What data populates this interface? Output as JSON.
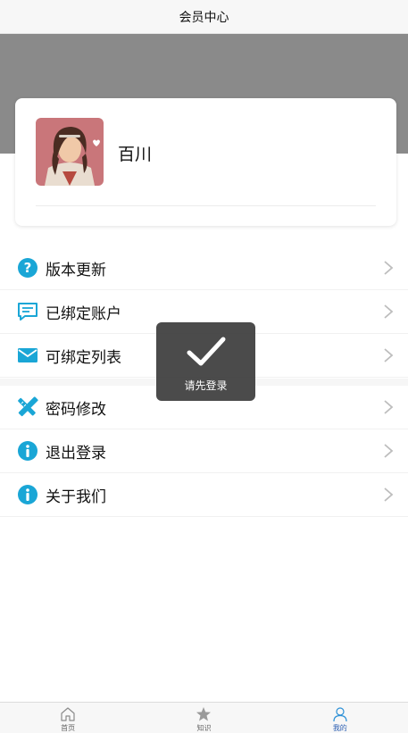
{
  "header": {
    "title": "会员中心"
  },
  "profile": {
    "username": "百川"
  },
  "menu": {
    "group1": [
      {
        "label": "版本更新",
        "icon": "question-circle-icon"
      },
      {
        "label": "已绑定账户",
        "icon": "message-icon"
      },
      {
        "label": "可绑定列表",
        "icon": "mail-icon"
      }
    ],
    "group2": [
      {
        "label": "密码修改",
        "icon": "ruler-pencil-icon"
      },
      {
        "label": "退出登录",
        "icon": "info-circle-icon"
      },
      {
        "label": "关于我们",
        "icon": "info-circle-icon"
      }
    ]
  },
  "toast": {
    "message": "请先登录",
    "icon": "checkmark-icon"
  },
  "tabbar": {
    "items": [
      {
        "label": "首页",
        "icon": "home-icon"
      },
      {
        "label": "知识",
        "icon": "star-icon"
      },
      {
        "label": "我的",
        "icon": "user-icon",
        "active": true
      }
    ]
  },
  "colors": {
    "accent": "#1aa6d6",
    "banner": "#8a8a8a",
    "active_tab": "#2a5db0"
  }
}
